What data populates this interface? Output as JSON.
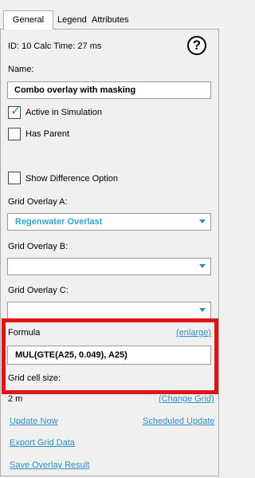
{
  "tabs": [
    {
      "label": "General"
    },
    {
      "label": "Legend"
    },
    {
      "label": "Attributes"
    }
  ],
  "info": {
    "id_line": "ID: 10 Calc Time: 27 ms",
    "help_glyph": "?"
  },
  "name_section": {
    "label": "Name:",
    "value": "Combo overlay with masking"
  },
  "options": {
    "active": {
      "label": "Active in Simulation",
      "checked": true
    },
    "has_parent": {
      "label": "Has Parent",
      "checked": false
    },
    "show_difference": {
      "label": "Show Difference Option",
      "checked": false
    }
  },
  "grid_overlays": {
    "a_label": "Grid Overlay A:",
    "a_value": "Regenwater Overlast",
    "b_label": "Grid Overlay B:",
    "b_value": "",
    "c_label": "Grid Overlay C:",
    "c_value": ""
  },
  "formula": {
    "label": "Formula",
    "enlarge": "(enlarge)",
    "value": "MUL(GTE(A25, 0.049), A25)"
  },
  "grid_cell": {
    "label": "Grid cell size:",
    "value": "2 m",
    "change": "(Change Grid)"
  },
  "actions": {
    "update_now": "Update Now",
    "scheduled_update": "Scheduled Update",
    "export_grid": "Export Grid Data",
    "save_overlay": "Save Overlay Result"
  },
  "colors": {
    "link": "#2f8fc6",
    "highlight": "#e01414",
    "check": "#1e90d6"
  }
}
